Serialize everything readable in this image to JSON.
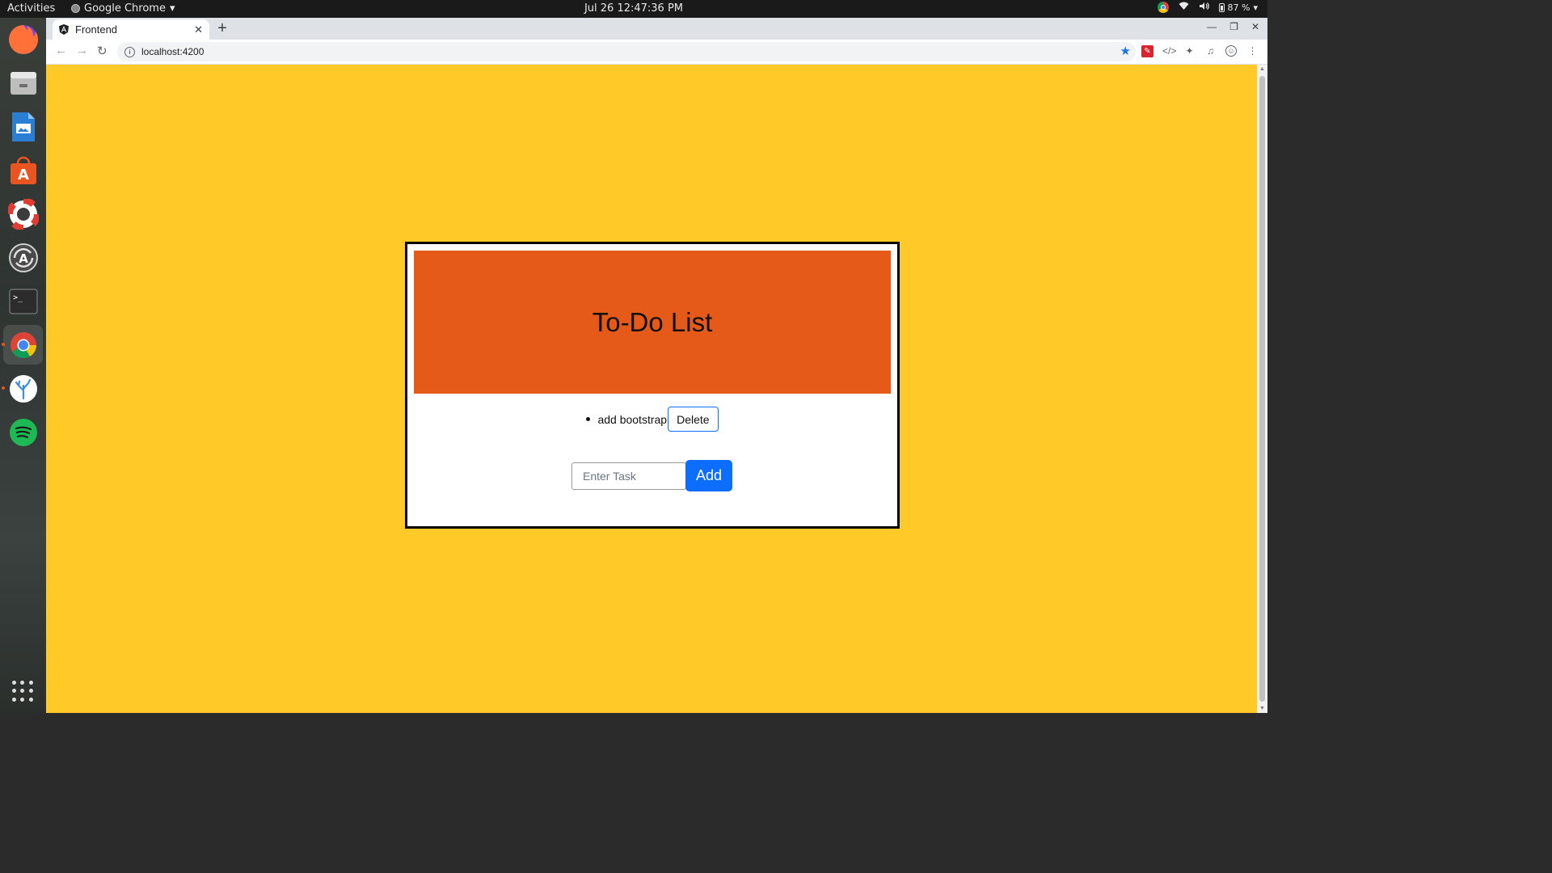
{
  "topbar": {
    "activities": "Activities",
    "app_name": "Google Chrome",
    "clock": "Jul 26  12:47:36 PM",
    "battery": "87 %",
    "icons": [
      "chrome-icon",
      "wifi-icon",
      "volume-icon",
      "battery-icon",
      "system-menu-icon"
    ]
  },
  "dock": {
    "items": [
      {
        "name": "firefox-icon",
        "color": "#ff7139"
      },
      {
        "name": "files-icon",
        "color": "#a0a0a0"
      },
      {
        "name": "libreoffice-writer-icon",
        "color": "#2a7fd4"
      },
      {
        "name": "software-center-icon",
        "color": "#e95420"
      },
      {
        "name": "help-icon",
        "color": "#e03c31"
      },
      {
        "name": "software-updater-icon",
        "color": "#555555"
      },
      {
        "name": "terminal-icon",
        "color": "#2c2c2c"
      },
      {
        "name": "chrome-icon",
        "color": "#4285f4"
      },
      {
        "name": "app-icon",
        "color": "#3d8fd6"
      },
      {
        "name": "spotify-icon",
        "color": "#1db954"
      }
    ],
    "show_apps": "show-applications-icon"
  },
  "browser": {
    "tab_title": "Frontend",
    "url": "localhost:4200"
  },
  "page": {
    "background": "#ffca28",
    "header_color": "#e65a19",
    "title": "To-Do List",
    "tasks": [
      {
        "text": "add bootstrap",
        "delete_label": "Delete"
      }
    ],
    "input_placeholder": "Enter Task",
    "add_label": "Add"
  }
}
